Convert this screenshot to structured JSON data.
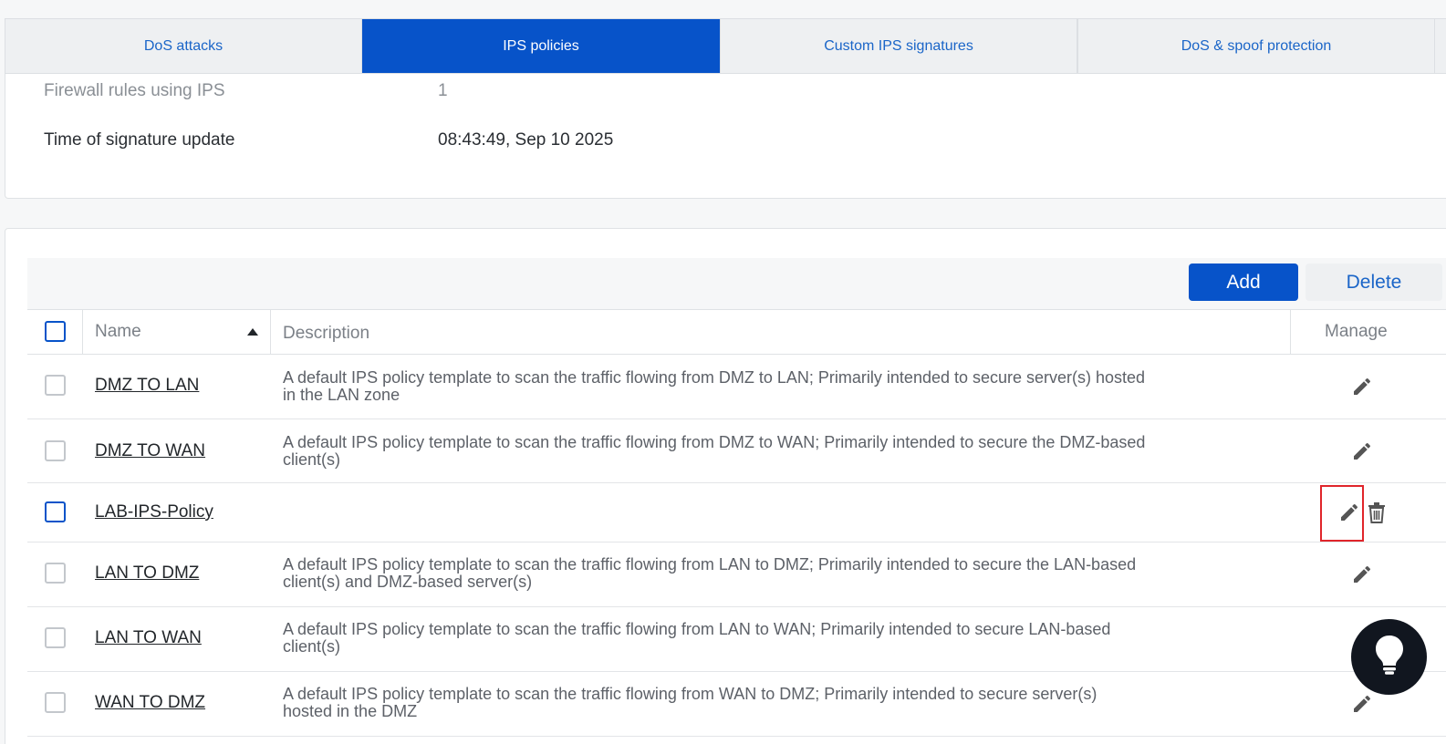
{
  "tabs": [
    {
      "label": "DoS attacks"
    },
    {
      "label": "IPS policies"
    },
    {
      "label": "Custom IPS signatures"
    },
    {
      "label": "DoS & spoof protection"
    }
  ],
  "summary": {
    "firewall_rules_label": "Firewall rules using IPS",
    "firewall_rules_value": "1",
    "signature_update_label": "Time of signature update",
    "signature_update_value": "08:43:49, Sep 10 2025"
  },
  "toolbar": {
    "add_label": "Add",
    "delete_label": "Delete"
  },
  "table": {
    "columns": {
      "name": "Name",
      "description": "Description",
      "manage": "Manage"
    },
    "sort": {
      "column": "Name",
      "direction": "ascending"
    },
    "rows": [
      {
        "name": "DMZ TO LAN",
        "desc1": "A default IPS policy template to scan the traffic flowing from DMZ to LAN; Primarily intended to secure server(s) hosted",
        "desc2": "in the LAN zone"
      },
      {
        "name": "DMZ TO WAN",
        "desc1": "A default IPS policy template to scan the traffic flowing from DMZ to WAN; Primarily intended to secure the DMZ-based",
        "desc2": "client(s)"
      },
      {
        "name": "LAB-IPS-Policy",
        "desc1": "",
        "desc2": ""
      },
      {
        "name": "LAN TO DMZ",
        "desc1": "A default IPS policy template to scan the traffic flowing from LAN to DMZ; Primarily intended to secure the LAN-based",
        "desc2": "client(s) and DMZ-based server(s)"
      },
      {
        "name": "LAN TO WAN",
        "desc1": "A default IPS policy template to scan the traffic flowing from LAN to WAN; Primarily intended to secure LAN-based",
        "desc2": "client(s)"
      },
      {
        "name": "WAN TO DMZ",
        "desc1": "A default IPS policy template to scan the traffic flowing from WAN to DMZ; Primarily intended to secure server(s)",
        "desc2": "hosted in the DMZ"
      }
    ]
  },
  "icons": {
    "edit": "pencil-icon",
    "delete": "trash-icon",
    "help": "lightbulb-icon"
  },
  "colors": {
    "accent": "#0753c9",
    "link": "#1a65c8",
    "highlight": "#e0252b"
  }
}
